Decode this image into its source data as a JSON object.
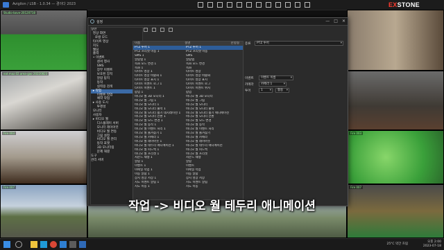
{
  "app": {
    "window_title": "Avigilon / LSB - 1.0.34 — 경이다 2023"
  },
  "brand": {
    "logo_ex": "EX",
    "logo_rest": "STONE"
  },
  "cameras": [
    {
      "label": "Studio-bove-20120718"
    },
    {
      "label": ""
    },
    {
      "label": ""
    },
    {
      "label": "eat.maz.02.area-gao 20220823"
    },
    {
      "label": ""
    },
    {
      "label": "Fire 003"
    },
    {
      "label": "Fire 003"
    },
    {
      "label": ""
    },
    {
      "label": "Fire 007"
    },
    {
      "label": "Fire 007"
    },
    {
      "label": ""
    }
  ],
  "dialog": {
    "title": "설정",
    "window_controls": [
      "—",
      "□",
      "✕"
    ],
    "tree": [
      "일반",
      "  영상 화면",
      "    로컬 모드",
      "  타이트 영상",
      "  지도",
      "  웹딩",
      "  출력",
      "  • 이벤트",
      "      센서 행사",
      "      SMS",
      "      장부 이벤트",
      "      보호된 장치",
      "      알람 탐지",
      "      동작",
      "      실력용 검색",
      "  ▸ 작업",
      "      이벤트 작업",
      "      예약 작업",
      "  ▸ 사용 도시",
      "      투명성",
      "  모니터",
      "  사용자",
      "  ▸ 비디오 월",
      "      디스플레이 서버",
      "      모니터 레이아웃",
      "      비디오 월 연동",
      "      그림 설정",
      "      비디오 월 관리",
      "      동작 포맷",
      "      3D 모니터링",
      "      문제 해결",
      "도구",
      "관리 서버"
    ],
    "selected_tree_index": 15,
    "table": {
      "headers": [
        "이름",
        "설명",
        "한정형"
      ],
      "rows": [
        [
          "PTZ 투어 1",
          "PTZ 투어 1"
        ],
        [
          "PTZ 프리셋 이동 1",
          "PTZ 프리셋 이동"
        ],
        [
          "SMS 1",
          "SMS"
        ],
        [
          "알람탭 1",
          "알람탭"
        ],
        [
          "녹화 모드 변경 1",
          "녹화 모드 변경"
        ],
        [
          "녹화 1",
          "녹화"
        ],
        [
          "타이트 영상 1",
          "타이트 영상"
        ],
        [
          "타이트 영상 비활화 1",
          "타이트 영상 비활화"
        ],
        [
          "타이트 영상 표시 1",
          "타이트 영상 표시"
        ],
        [
          "타이트 이벤트 로그 1",
          "타이트 이벤트 로그"
        ],
        [
          "타이트 이벤트 1",
          "타이트 이벤트 위치"
        ],
        [
          "팝업 1",
          "팝업"
        ],
        [
          "비디오 월 3D 모니터 1",
          "비디오 월 3D 모니터"
        ],
        [
          "비디오 월 그림 1",
          "비디오 월 그림"
        ],
        [
          "비디오 월 모니터 1",
          "비디오 월 모니터"
        ],
        [
          "비디오 월 모니터 출력 1",
          "비디오 월 모니터 출력"
        ],
        [
          "비디오 월 모니터 활기 데시레이션 1",
          "비디오 월 모니터 활기 애니메이션"
        ],
        [
          "비디오 월 모니터 전환 1",
          "비디오 월 모니터 전환"
        ],
        [
          "비디오 월 모드 변경 1",
          "비디오 월 모드 변경"
        ],
        [
          "비디오 월 동작 1",
          "비디오 월 동작"
        ],
        [
          "비디오 월 이벤트 처리 1",
          "비디오 월 이벤트 처리"
        ],
        [
          "비디오 월 즐겨찾기 1",
          "비디오 월 즐겨찾기"
        ],
        [
          "비디오 월 카메라 1",
          "비디오 월 카메라"
        ],
        [
          "비디오 월 레이아웃 1",
          "비디오 월 레이아웃"
        ],
        [
          "비디오 월 테두리 애니메이션 1",
          "비디오 월 테두리 애니메이션"
        ],
        [
          "비디오 월 피드백 1",
          "비디오 월 피드백"
        ],
        [
          "비디오 월 프리셋 1",
          "비디오 월 프리셋"
        ],
        [
          "사운드 재생 1",
          "사운드 재생"
        ],
        [
          "알람 1",
          "알람"
        ],
        [
          "이벤트 1",
          "이벤트"
        ],
        [
          "이메일 작업 1",
          "이메일 작업"
        ],
        [
          "이동 알람 1",
          "이동 알람"
        ],
        [
          "장치 영상 저장 1",
          "장치 영상 저장"
        ],
        [
          "지도 이벤트 알림 1",
          "지도 이벤트 알림"
        ],
        [
          "지도 이동 1",
          "지도 이동"
        ]
      ],
      "selected_row_index": 0
    },
    "props": {
      "label_type": "종류",
      "type_value": "PTZ 투어",
      "label_event": "이벤트",
      "event_value": "이벤트 이름",
      "label_camera": "카메라",
      "camera_value": "카메라 1",
      "label_tour": "투어",
      "tour_value": "1",
      "tour_extra": "활용"
    }
  },
  "subtitle": "작업 -> 비디오 월 테두리 애니메이션",
  "taskbar": {
    "weather": "25°C 약간 흐림",
    "time": "오후 2:00",
    "date": "2023-07-18"
  }
}
